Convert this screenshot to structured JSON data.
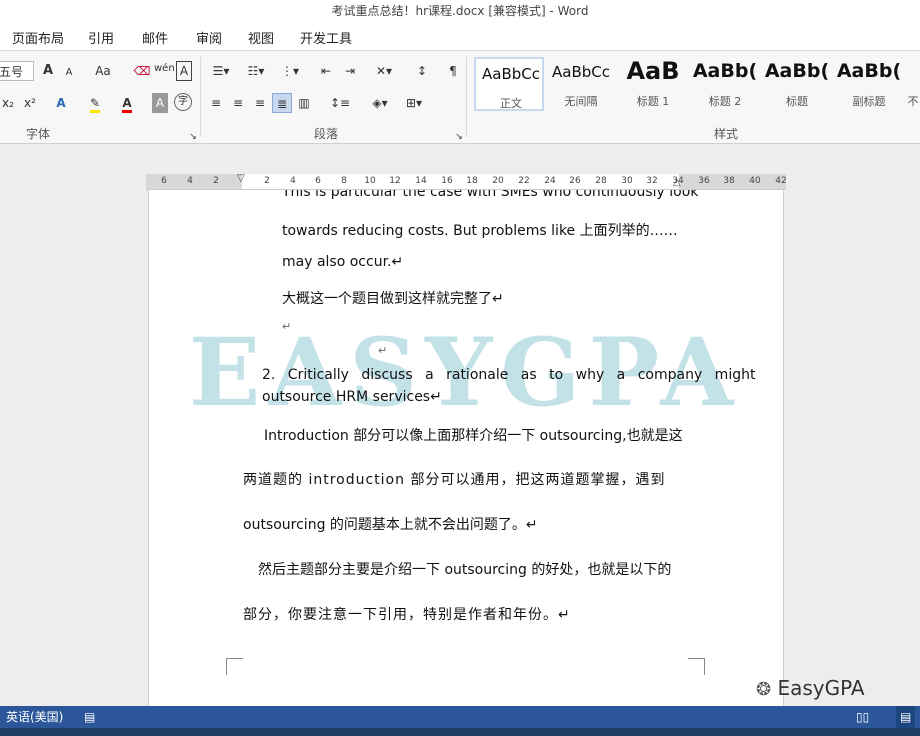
{
  "title_bar": {
    "title": "考试重点总结！hr课程.docx [兼容模式] - Word"
  },
  "menu": [
    "页面布局",
    "引用",
    "邮件",
    "审阅",
    "视图",
    "开发工具"
  ],
  "ribbon": {
    "font_size_value": "五号",
    "group_labels": {
      "font": "字体",
      "paragraph": "段落",
      "styles": "样式"
    },
    "font_buttons": {
      "grow": "A",
      "shrink": "A",
      "case": "Aa",
      "pinyin": "wén",
      "subscript": "x₂",
      "superscript": "x²"
    },
    "styles": [
      {
        "sample": "AaBbCc",
        "name": "正文"
      },
      {
        "sample": "AaBbCc",
        "name": "无间隔"
      },
      {
        "sample": "AaB",
        "name": "标题 1"
      },
      {
        "sample": "AaBb(",
        "name": "标题 2"
      },
      {
        "sample": "AaBb(",
        "name": "标题"
      },
      {
        "sample": "AaBb(",
        "name": "副标题"
      },
      {
        "sample": "",
        "name": "不"
      }
    ]
  },
  "ruler": {
    "ticks": [
      "6",
      "4",
      "2",
      "2",
      "4",
      "6",
      "8",
      "10",
      "12",
      "14",
      "16",
      "18",
      "20",
      "22",
      "24",
      "26",
      "28",
      "30",
      "32",
      "34",
      "36",
      "38",
      "40",
      "42"
    ]
  },
  "document": {
    "lines": [
      "This is particular the case with SMEs who continuously look",
      "towards reducing costs. But problems like  上面列举的……",
      "may also occur.↵",
      "大概这一个题目做到这样就完整了↵",
      "↵",
      "↵",
      "2. Critically discuss a rationale as to why a company might",
      "outsource HRM services↵",
      "Introduction 部分可以像上面那样介绍一下 outsourcing,也就是这",
      "两道题的  introduction  部分可以通用，把这两道题掌握，遇到",
      "outsourcing 的问题基本上就不会出问题了。↵",
      "然后主题部分主要是介绍一下 outsourcing 的好处，也就是以下的",
      "部分，你要注意一下引用，特别是作者和年份。↵"
    ],
    "watermark": "EASYGPA"
  },
  "status_bar": {
    "language": "英语(美国)"
  },
  "logo": {
    "text": "EasyGPA"
  }
}
